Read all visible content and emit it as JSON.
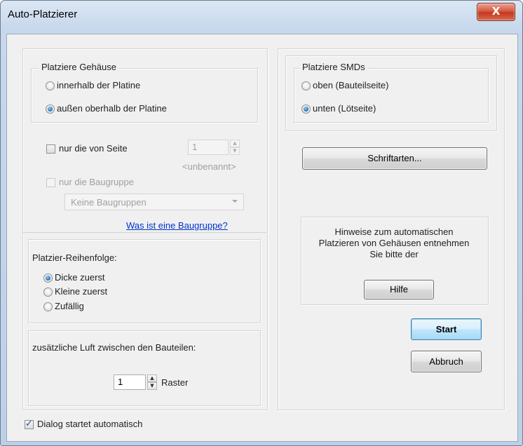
{
  "window": {
    "title": "Auto-Platzierer",
    "close_glyph": "X"
  },
  "placement": {
    "label": "Platziere Gehäuse",
    "options": [
      {
        "label": "innerhalb der Platine",
        "checked": false
      },
      {
        "label": "außen oberhalb der Platine",
        "checked": true
      }
    ]
  },
  "side_filter": {
    "label": "nur die von Seite",
    "checked": false,
    "value": "1",
    "hint": "<unbenannt>"
  },
  "assembly_filter": {
    "label": "nur die Baugruppe",
    "checked": false,
    "select_value": "Keine Baugruppen",
    "help_link": "Was ist eine Baugruppe?"
  },
  "order": {
    "label": "Platzier-Reihenfolge:",
    "options": [
      {
        "label": "Dicke zuerst",
        "checked": true
      },
      {
        "label": "Kleine zuerst",
        "checked": false
      },
      {
        "label": "Zufällig",
        "checked": false
      }
    ]
  },
  "spacing": {
    "label": "zusätzliche Luft zwischen den Bauteilen:",
    "value": "1",
    "unit": "Raster"
  },
  "smd": {
    "label": "Platziere SMDs",
    "options": [
      {
        "label": "oben (Bauteilseite)",
        "checked": false
      },
      {
        "label": "unten (Lötseite)",
        "checked": true
      }
    ]
  },
  "fonts_button": "Schriftarten...",
  "info": {
    "text_line1": "Hinweise zum automatischen",
    "text_line2": "Platzieren von Gehäusen entnehmen",
    "text_line3": "Sie bitte der",
    "help_button": "Hilfe"
  },
  "start_button": "Start",
  "cancel_button": "Abbruch",
  "autostart": {
    "label": "Dialog startet automatisch",
    "checked": true
  },
  "colors": {
    "accent": "#2f7fc8",
    "link": "#0033cc",
    "close": "#c43a20"
  }
}
